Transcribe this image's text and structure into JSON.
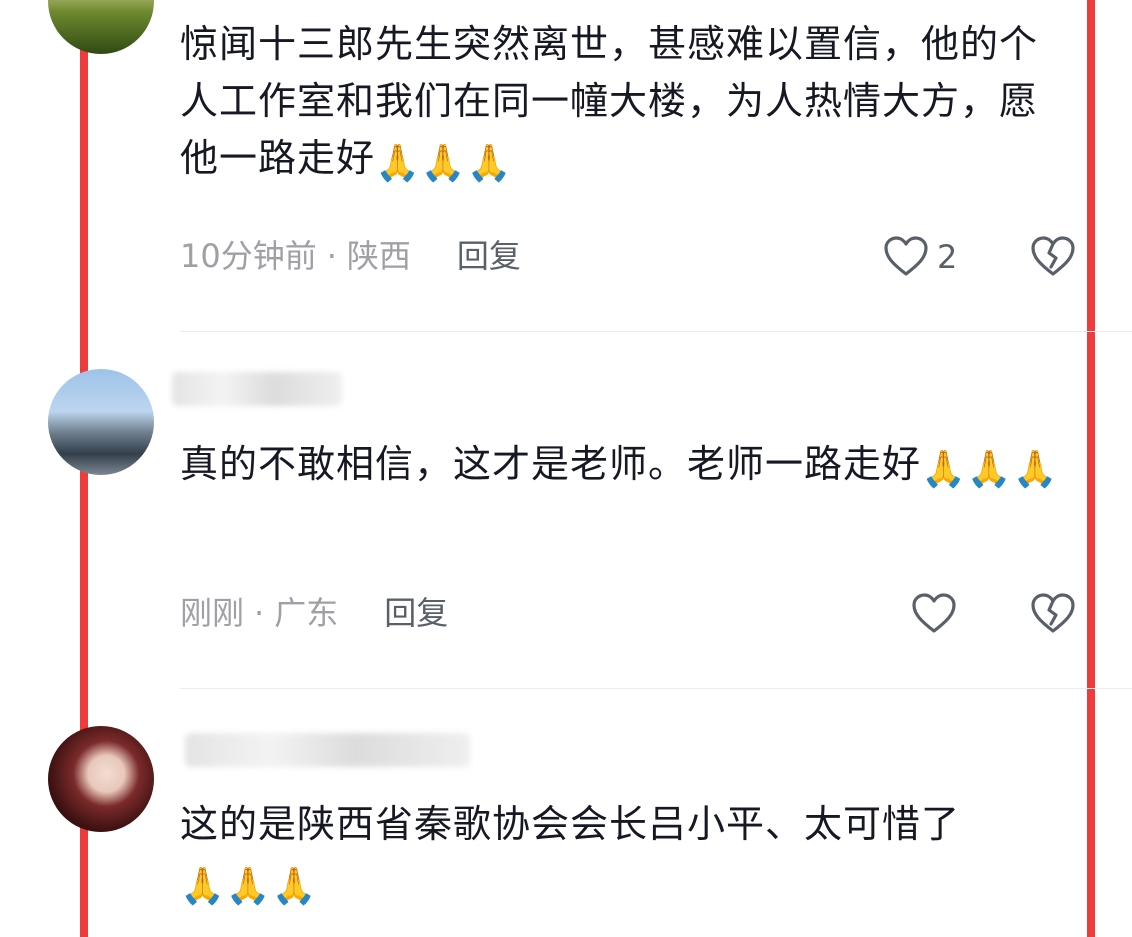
{
  "comments": [
    {
      "text": "惊闻十三郎先生突然离世，甚感难以置信，他的个人工作室和我们在同一幢大楼，为人热情大方，愿他一路走好",
      "emoji": "🙏🙏🙏",
      "time": "10分钟前",
      "location": "陕西",
      "reply_label": "回复",
      "like_count": "2"
    },
    {
      "text": "真的不敢相信，这才是老师。老师一路走好",
      "emoji": "🙏🙏🙏",
      "time": "刚刚",
      "location": "广东",
      "reply_label": "回复",
      "like_count": ""
    },
    {
      "text": "这的是陕西省秦歌协会会长吕小平、太可惜了",
      "emoji": "🙏🙏🙏"
    }
  ],
  "separator": "·",
  "icons": {
    "like": "heart-outline-icon",
    "dislike": "broken-heart-icon"
  },
  "colors": {
    "highlight_border": "#ef3b3b",
    "meta_text": "#9fa0a5",
    "body_text": "#161823"
  }
}
